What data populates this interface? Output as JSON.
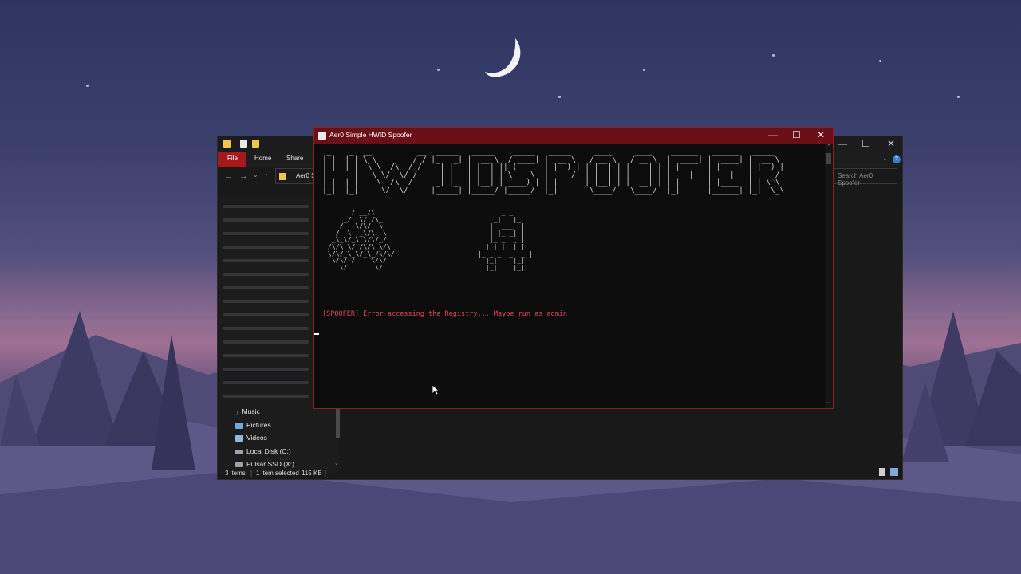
{
  "wallpaper": {
    "moon": "crescent-moon"
  },
  "explorer": {
    "tabs": {
      "file": "File",
      "home": "Home",
      "share": "Share"
    },
    "address": "Aer0 Simple HWID Spoofer",
    "address_visible": "Aer0 Sp",
    "search_placeholder": "Search Aer0 Spoofer",
    "controls": {
      "minimize": "—",
      "maximize": "☐",
      "close": "✕"
    },
    "nav": {
      "back": "←",
      "forward": "→",
      "up": "↑"
    },
    "sidebar": [
      {
        "label": "Music",
        "icon": "music-icon"
      },
      {
        "label": "Pictures",
        "icon": "pictures-icon"
      },
      {
        "label": "Videos",
        "icon": "videos-icon"
      },
      {
        "label": "Local Disk (C:)",
        "icon": "disk-icon"
      },
      {
        "label": "Pulsar SSD (X:)",
        "icon": "disk-icon"
      }
    ],
    "status": {
      "items": "3 items",
      "selected": "1 item selected",
      "size": "115 KB"
    }
  },
  "console": {
    "title": "Aer0 Simple HWID Spoofer",
    "controls": {
      "minimize": "—",
      "maximize": "☐",
      "close": "✕"
    },
    "banner": " _    _  __          __  _____   _____    _____   _____     ____     ____    ______   ______   _____\n| |  | | \\ \\        / / |_   _| |  __ \\  / ____| |  __ \\   / __ \\   / __ \\  |  ____| |  ____| |  __ \\\n| |__| |  \\ \\  /\\  / /    | |   | |  | || (___   | |__) | | |  | | | |  | | | |__    | |__    | |__) |\n|  __  |   \\ \\/  \\/ /     | |   | |  | | \\___ \\  |  ___/  | |  | | | |  | | |  __|   |  __|   |  _  /\n| |  | |    \\  /\\  /     _| |_  | |__| | ____) | | |      | |__| | | |__| | | |      | |____  | | \\ \\\n|_|  |_|     \\/  \\/     |_____| |_____/ |_____/  |_|       \\____/   \\____/  |_|      |______| |_|  \\_\\",
    "art_left": "       / __/\\\n     _/  \\/ /\\_\n    /   \\/\\/  \\\n   /  \\  _\\/\\  \\\n  _\\_\\/_\\ \\/\\/_/\n /\\/\\ \\/ /\\/\\ \\/\\\n \\/\\/_\\_\\/_\\_/\\/\\/\n  \\/\\/ /    \\/\\/\n    \\/       \\/",
    "art_right": "       _ _\n     _|   |_\n    |  ___  |\n    | |_ _| |\n    |_ _  _ |\n  _|_|_|__|_|_\n |_ _ _  _  _ |\n   |_|    |_|\n   |_|    |_|",
    "error": "[SPOOFER] Error accessing the Registry... Maybe run as admin"
  }
}
